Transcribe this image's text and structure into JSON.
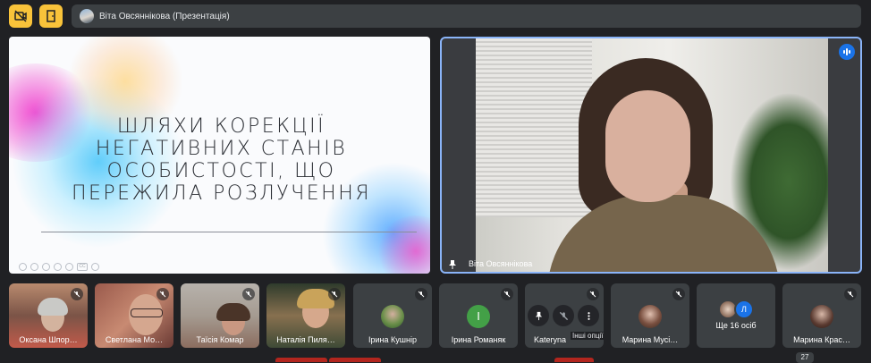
{
  "topbar": {
    "presenter_label": "Віта Овсяннікова (Презентація)"
  },
  "slide": {
    "title_lines": [
      "ШЛЯХИ КОРЕКЦІЇ",
      "НЕГАТИВНИХ СТАНІВ",
      "ОСОБИСТОСТІ, ЩО",
      "ПЕРЕЖИЛА РОЗЛУЧЕННЯ"
    ]
  },
  "speaker": {
    "name": "Віта Овсяннікова"
  },
  "participants": [
    {
      "name": "Оксана Шпор…",
      "avatar_letter": ""
    },
    {
      "name": "Светлана Мо…",
      "avatar_letter": ""
    },
    {
      "name": "Таїсія Комар",
      "avatar_letter": ""
    },
    {
      "name": "Наталія Пиля…",
      "avatar_letter": ""
    },
    {
      "name": "Ірина Кушнір",
      "avatar_letter": ""
    },
    {
      "name": "Ірина Романяк",
      "avatar_letter": "І"
    },
    {
      "name": "Kateryna",
      "avatar_letter": ""
    },
    {
      "name": "Марина Мусі…",
      "avatar_letter": ""
    },
    {
      "name": "Ще 16 осіб",
      "avatar_letter": "Л"
    },
    {
      "name": "Марина Крас…",
      "avatar_letter": ""
    }
  ],
  "overlay_tooltip": "Інші опції",
  "participant_count": "27",
  "colors": {
    "accent_yellow": "#f9c33a",
    "speaker_border": "#8ab4f8",
    "talk_indicator": "#1a73e8",
    "avatar_green": "#43a047",
    "avatar_blue": "#1a73e8"
  }
}
